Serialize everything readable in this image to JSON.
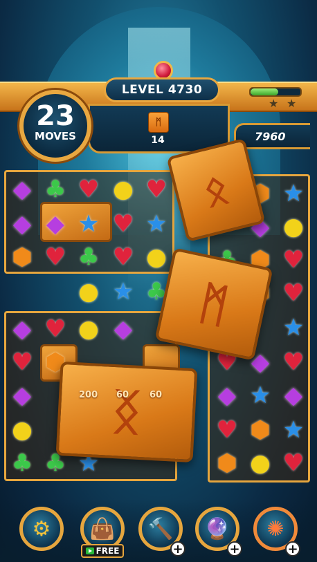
{
  "hud": {
    "level_label": "LEVEL",
    "level_number": "4730",
    "moves_count": "23",
    "moves_label": "MOVES",
    "goal_count": "14",
    "goal_icon": "rune-tile-icon",
    "score": "7960",
    "progress_fraction": 0.55,
    "stars_earned": 0,
    "stars_total": 2
  },
  "float_scores": [
    "200",
    "60",
    "60"
  ],
  "boosters": [
    {
      "name": "settings",
      "icon": "gear-icon"
    },
    {
      "name": "bag",
      "icon": "treasure-bag-icon",
      "badge": "FREE"
    },
    {
      "name": "hammer",
      "icon": "hammer-icon",
      "badge": "+"
    },
    {
      "name": "orb",
      "icon": "crystal-orb-icon",
      "badge": "+"
    },
    {
      "name": "compass",
      "icon": "compass-icon",
      "badge": "+"
    }
  ],
  "colors": {
    "gold": "#e6a63e",
    "panel": "#0b2538",
    "accent_green": "#3aa52a"
  }
}
